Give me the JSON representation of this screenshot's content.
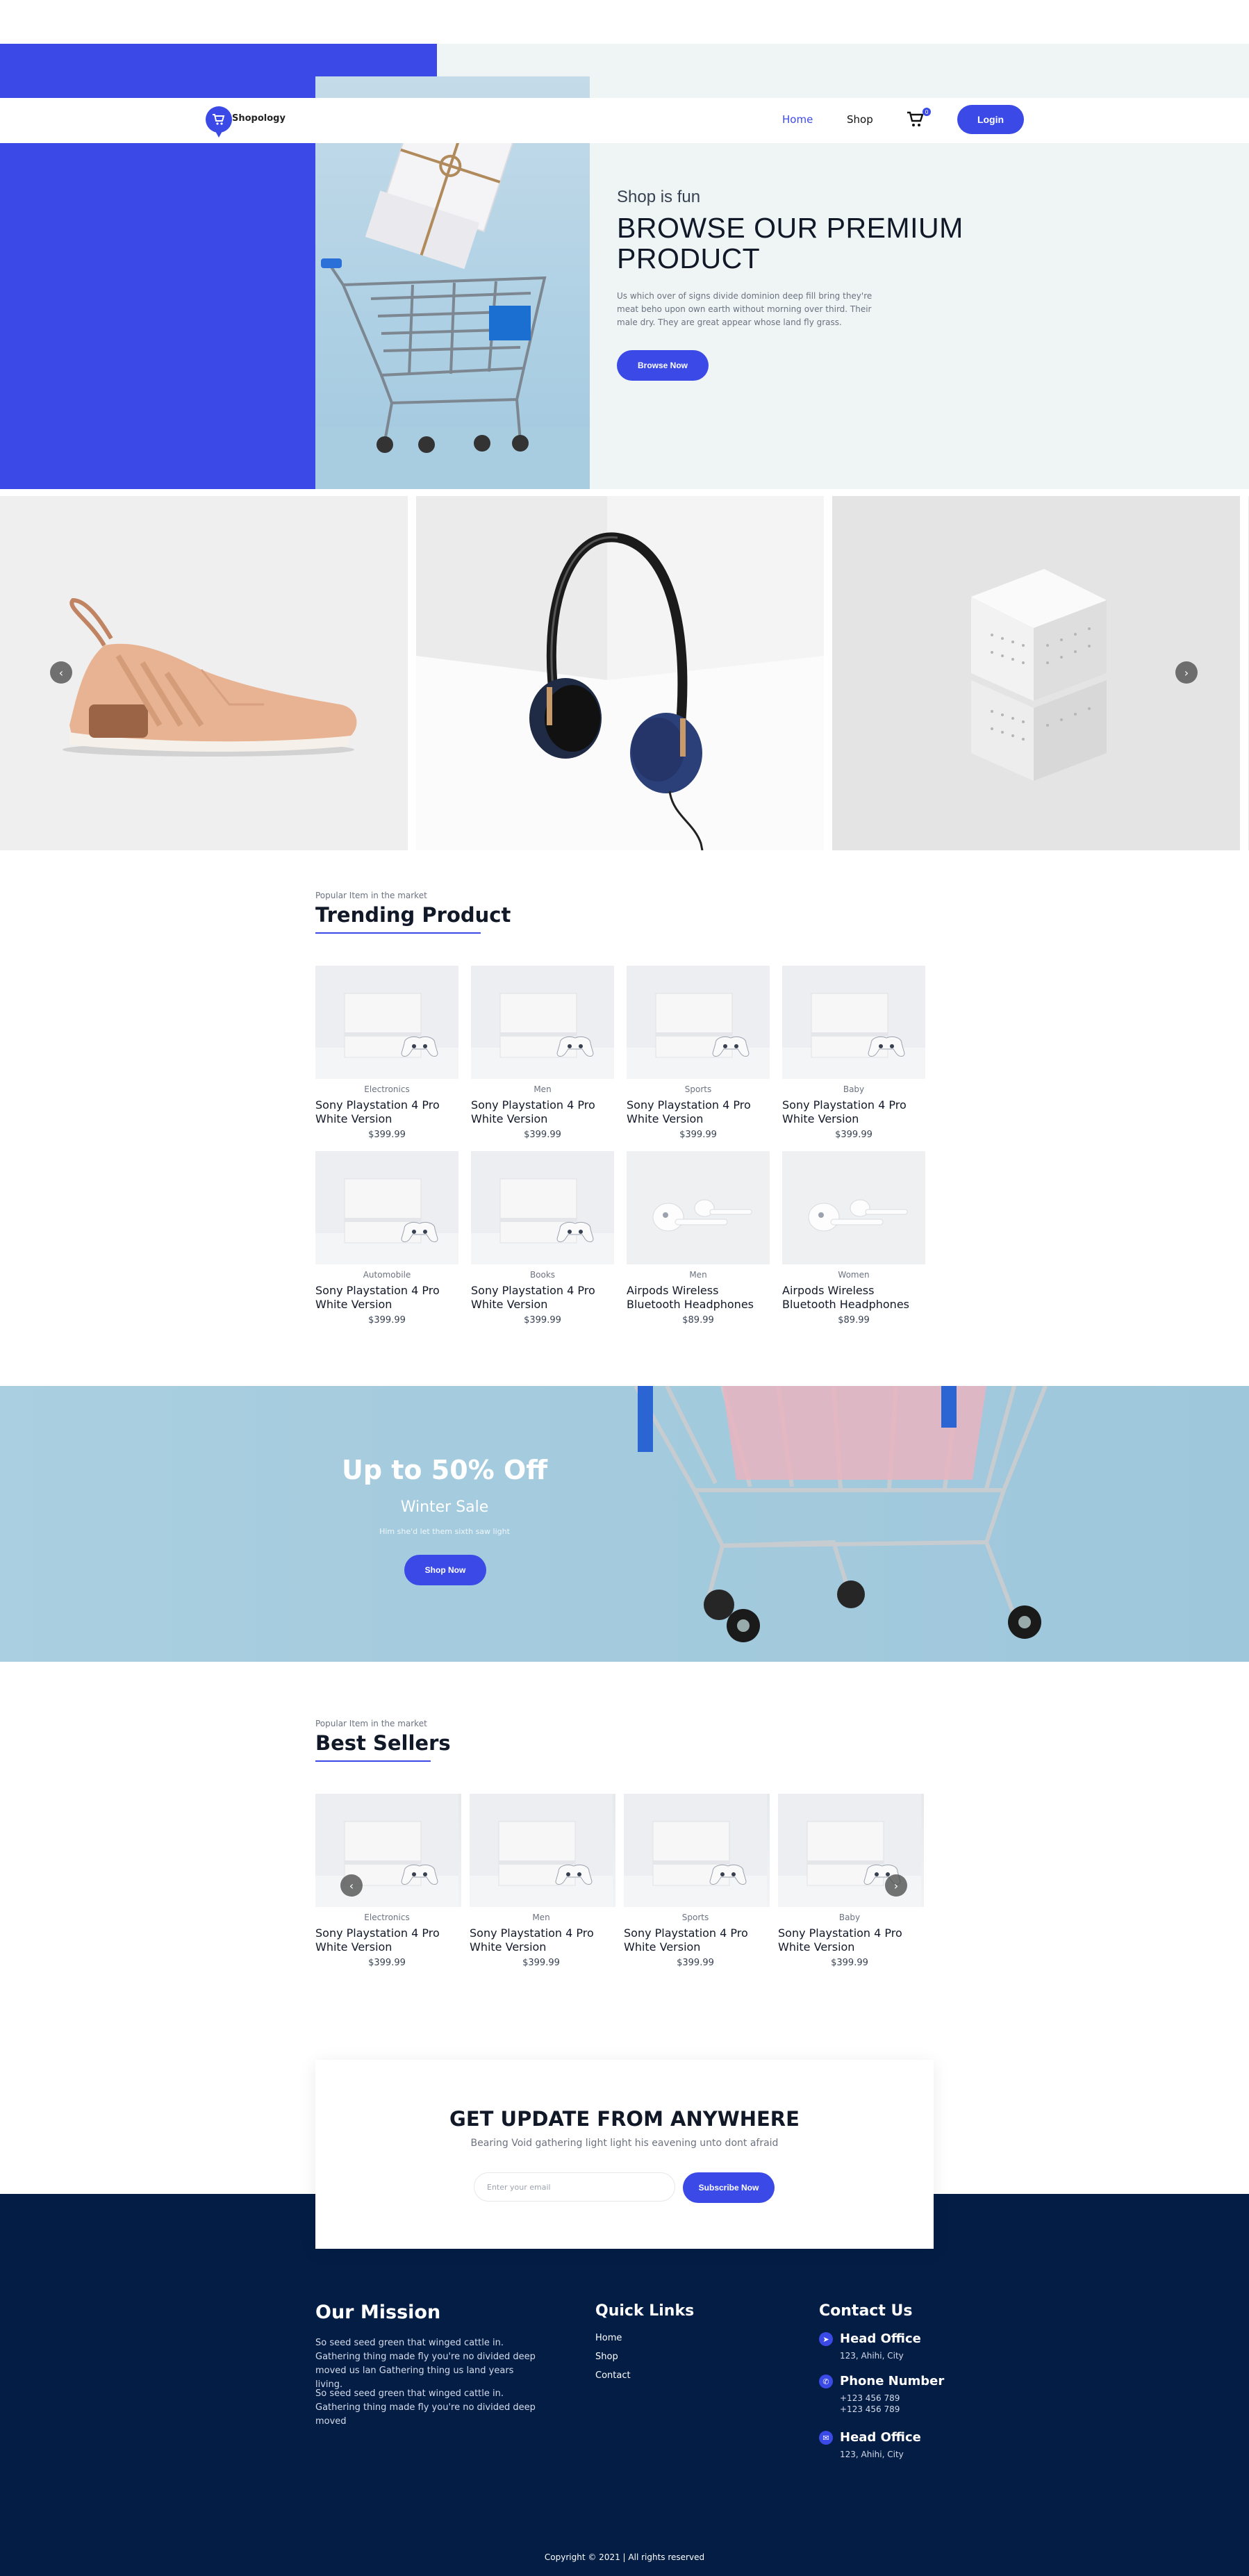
{
  "colors": {
    "accent": "#3b4ae6",
    "footer_bg": "#031d45",
    "hero_bg": "#eff4f5",
    "sale_bg": "#a9cfe0"
  },
  "brand": {
    "name": "Shopology",
    "logo_icon": "cart-icon"
  },
  "nav": {
    "links": [
      "Home",
      "Shop"
    ],
    "active": "Home",
    "cart_count": "0",
    "login": "Login"
  },
  "hero": {
    "subtitle": "Shop is fun",
    "title": "BROWSE OUR PREMIUM PRODUCT",
    "description": "Us which over of signs divide dominion deep fill bring they're meat beho upon own earth without morning over third. Their male dry. They are great appear whose land fly grass.",
    "button": "Browse Now"
  },
  "carousel": {
    "slides": [
      "sneaker",
      "headphones",
      "cube-speaker"
    ],
    "prev_icon": "chevron-left-icon",
    "next_icon": "chevron-right-icon"
  },
  "trending": {
    "kicker": "Popular Item in the market",
    "title": "Trending Product",
    "products": [
      {
        "category": "Electronics",
        "name": "Sony Playstation 4 Pro White Version",
        "price": "$399.99",
        "image": "ps4"
      },
      {
        "category": "Men",
        "name": "Sony Playstation 4 Pro White Version",
        "price": "$399.99",
        "image": "ps4"
      },
      {
        "category": "Sports",
        "name": "Sony Playstation 4 Pro White Version",
        "price": "$399.99",
        "image": "ps4"
      },
      {
        "category": "Baby",
        "name": "Sony Playstation 4 Pro White Version",
        "price": "$399.99",
        "image": "ps4"
      },
      {
        "category": "Automobile",
        "name": "Sony Playstation 4 Pro White Version",
        "price": "$399.99",
        "image": "ps4"
      },
      {
        "category": "Books",
        "name": "Sony Playstation 4 Pro White Version",
        "price": "$399.99",
        "image": "ps4"
      },
      {
        "category": "Men",
        "name": "Airpods Wireless Bluetooth Headphones",
        "price": "$89.99",
        "image": "airpods"
      },
      {
        "category": "Women",
        "name": "Airpods Wireless Bluetooth Headphones",
        "price": "$89.99",
        "image": "airpods"
      }
    ]
  },
  "sale": {
    "title": "Up to 50% Off",
    "subtitle": "Winter Sale",
    "description": "Him she'd let them sixth saw light",
    "button": "Shop Now"
  },
  "bestsellers": {
    "kicker": "Popular Item in the market",
    "title": "Best Sellers",
    "products": [
      {
        "category": "Electronics",
        "name": "Sony Playstation 4 Pro White Version",
        "price": "$399.99"
      },
      {
        "category": "Men",
        "name": "Sony Playstation 4 Pro White Version",
        "price": "$399.99"
      },
      {
        "category": "Sports",
        "name": "Sony Playstation 4 Pro White Version",
        "price": "$399.99"
      },
      {
        "category": "Baby",
        "name": "Sony Playstation 4 Pro White Version",
        "price": "$399.99"
      }
    ]
  },
  "newsletter": {
    "title": "GET UPDATE FROM ANYWHERE",
    "subtitle": "Bearing Void gathering light light his eavening unto dont afraid",
    "placeholder": "Enter your email",
    "button": "Subscribe Now"
  },
  "footer": {
    "mission_title": "Our Mission",
    "mission_p1": "So seed seed green that winged cattle in. Gathering thing made fly you're no divided deep moved us lan Gathering thing us land years living.",
    "mission_p2": "So seed seed green that winged cattle in. Gathering thing made fly you're no divided deep moved",
    "quick_title": "Quick Links",
    "quick_links": [
      "Home",
      "Shop",
      "Contact"
    ],
    "contact_title": "Contact Us",
    "contacts": [
      {
        "title": "Head Office",
        "lines": [
          "123, Ahihi, City"
        ],
        "icon": "location-arrow-icon"
      },
      {
        "title": "Phone Number",
        "lines": [
          "+123 456 789",
          "+123 456 789"
        ],
        "icon": "phone-icon"
      },
      {
        "title": "Head Office",
        "lines": [
          "123, Ahihi, City"
        ],
        "icon": "envelope-icon"
      }
    ],
    "copyright": "Copyright © 2021 | All rights reserved"
  }
}
